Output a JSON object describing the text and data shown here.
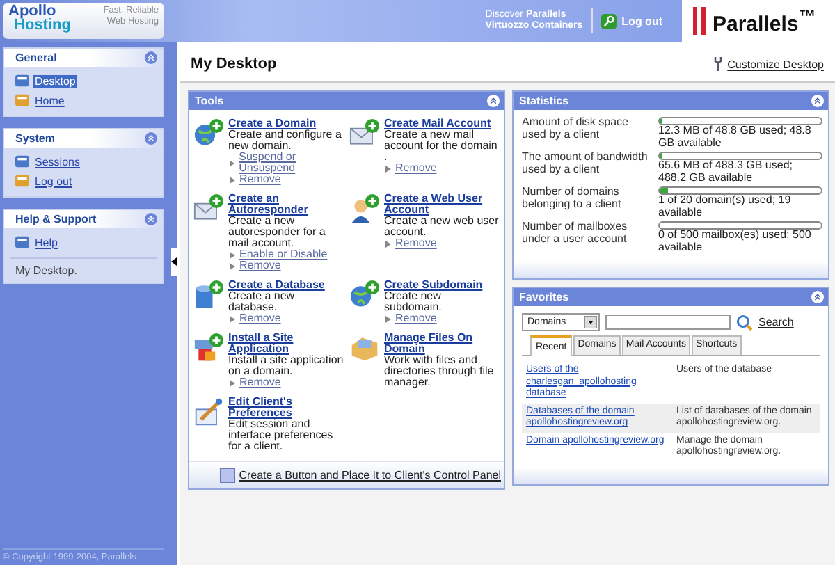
{
  "header": {
    "logo_line1": "Apollo",
    "logo_line2": "Hosting",
    "tagline_line1": "Fast, Reliable",
    "tagline_line2": "Web Hosting",
    "promo_line1": "Discover **Parallels**",
    "promo_line2": "Virtuozzo Containers",
    "logout": "Log out",
    "brand": "Parallels$^{™}$"
  },
  "sidebar": {
    "sections": [
      {
        "title": "General",
        "items": [
          {
            "label": "Desktop",
            "selected": true
          },
          {
            "label": "Home",
            "selected": false
          }
        ]
      },
      {
        "title": "System",
        "items": [
          {
            "label": "Sessions",
            "selected": false
          },
          {
            "label": "Log out",
            "selected": false
          }
        ]
      },
      {
        "title": "Help & Support",
        "items": [
          {
            "label": "Help",
            "selected": false
          }
        ],
        "note": "My Desktop."
      }
    ],
    "copyright": "© Copyright 1999-2004, Parallels"
  },
  "page": {
    "title": "My Desktop",
    "customize": "Customize Desktop"
  },
  "tools": {
    "title": "Tools",
    "items": [
      {
        "title": "Create a Domain",
        "description": "Create and configure a new domain.",
        "links": [
          "Suspend or Unsuspend",
          "Remove"
        ]
      },
      {
        "title": "Create Mail Account",
        "description": "Create a new mail account for the domain .",
        "links": [
          "Remove"
        ]
      },
      {
        "title": "Create an Autoresponder",
        "description": "Create a new autoresponder for a mail account.",
        "links": [
          "Enable or Disable",
          "Remove"
        ]
      },
      {
        "title": "Create a Web User Account",
        "description": "Create a new web user account.",
        "links": [
          "Remove"
        ]
      },
      {
        "title": "Create a Database",
        "description": "Create a new database.",
        "links": [
          "Remove"
        ]
      },
      {
        "title": "Create Subdomain",
        "description": "Create new subdomain.",
        "links": [
          "Remove"
        ]
      },
      {
        "title": "Install a Site Application",
        "description": "Install a site application on a domain.",
        "links": [
          "Remove"
        ]
      },
      {
        "title": "Manage Files On Domain",
        "description": "Work with files and directories through file manager."
      },
      {
        "title": "Edit Client's Preferences",
        "description": "Edit session and interface preferences for a client."
      }
    ],
    "footer_link": "Create a Button and Place It to Client's Control Panel"
  },
  "statistics": {
    "title": "Statistics",
    "rows": [
      {
        "label": "Amount of disk space used by a client",
        "level": 0.02,
        "reading": "12.3 MB of 48.8 GB used; 48.8 GB available"
      },
      {
        "label": "The amount of bandwidth used by a client",
        "level": 0.02,
        "reading": "65.6 MB of 488.3 GB used; 488.2 GB available"
      },
      {
        "label": "Number of domains belonging to a client",
        "level": 0.05,
        "reading": "1 of 20 domain(s) used; 19 available"
      },
      {
        "label": "Number of mailboxes under a user account",
        "level": 0,
        "reading": "0 of 500 mailbox(es) used; 500 available"
      }
    ]
  },
  "favorites": {
    "title": "Favorites",
    "select": "Domains",
    "search": "Search",
    "tabs": [
      {
        "label": "Recent",
        "selected": true
      },
      {
        "label": "Domains",
        "selected": false
      },
      {
        "label": "Mail Accounts",
        "selected": false
      },
      {
        "label": "Shortcuts",
        "selected": false
      }
    ],
    "rows": [
      {
        "link": "Users of the charlesgan_apollohosting database",
        "description": "Users of the database",
        "selected": false
      },
      {
        "link": "Databases of the domain apollohostingreview.org",
        "description": "List of databases of the domain apollohostingreview.org.",
        "selected": true
      },
      {
        "link": "Domain apollohostingreview.org",
        "description": "Manage the domain apollohostingreview.org.",
        "selected": false
      }
    ]
  }
}
